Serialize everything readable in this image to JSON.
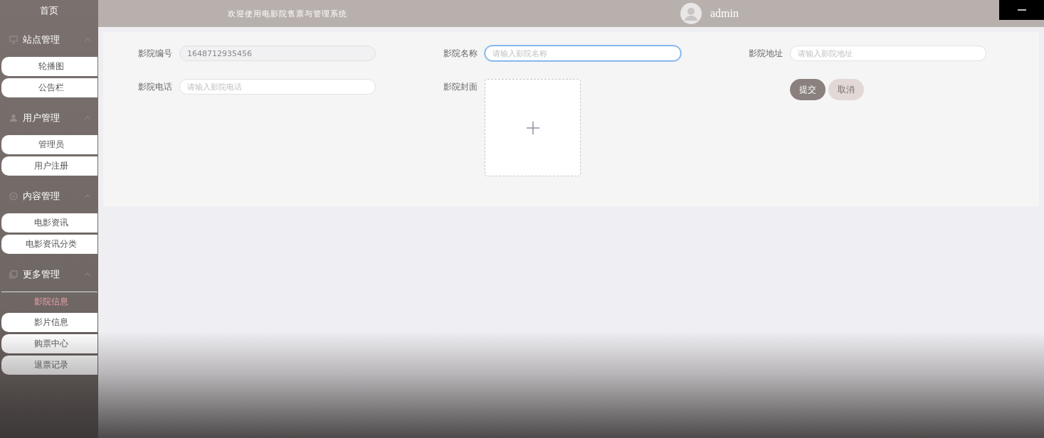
{
  "header": {
    "title": "欢迎使用电影院售票与管理系统",
    "user": "admin"
  },
  "sidebar": {
    "home": "首页",
    "groups": [
      {
        "title": "站点管理",
        "expanded": true,
        "items": [
          {
            "label": "轮播图",
            "selected": false
          },
          {
            "label": "公告栏",
            "selected": false
          }
        ]
      },
      {
        "title": "用户管理",
        "expanded": true,
        "items": [
          {
            "label": "管理员",
            "selected": false
          },
          {
            "label": "用户注册",
            "selected": false
          }
        ]
      },
      {
        "title": "内容管理",
        "expanded": true,
        "items": [
          {
            "label": "电影资讯",
            "selected": false
          },
          {
            "label": "电影资讯分类",
            "selected": false
          }
        ]
      },
      {
        "title": "更多管理",
        "expanded": true,
        "items": [
          {
            "label": "影院信息",
            "selected": true
          },
          {
            "label": "影片信息",
            "selected": false
          },
          {
            "label": "购票中心",
            "selected": false
          },
          {
            "label": "退票记录",
            "selected": false
          }
        ]
      }
    ]
  },
  "form": {
    "fields": [
      {
        "label": "影院编号",
        "kind": "text",
        "value": "1648712935456",
        "disabled": true,
        "focused": false
      },
      {
        "label": "影院名称",
        "kind": "text",
        "placeholder": "请输入影院名称",
        "disabled": false,
        "focused": true
      },
      {
        "label": "影院地址",
        "kind": "text",
        "placeholder": "请输入影院地址",
        "disabled": false,
        "focused": false
      },
      {
        "label": "影院电话",
        "kind": "text",
        "placeholder": "请输入影院电话",
        "disabled": false,
        "focused": false
      },
      {
        "label": "影院封面",
        "kind": "upload"
      }
    ],
    "buttons": [
      {
        "label": "提交",
        "kind": "primary"
      },
      {
        "label": "取消",
        "kind": "secondary"
      }
    ]
  }
}
